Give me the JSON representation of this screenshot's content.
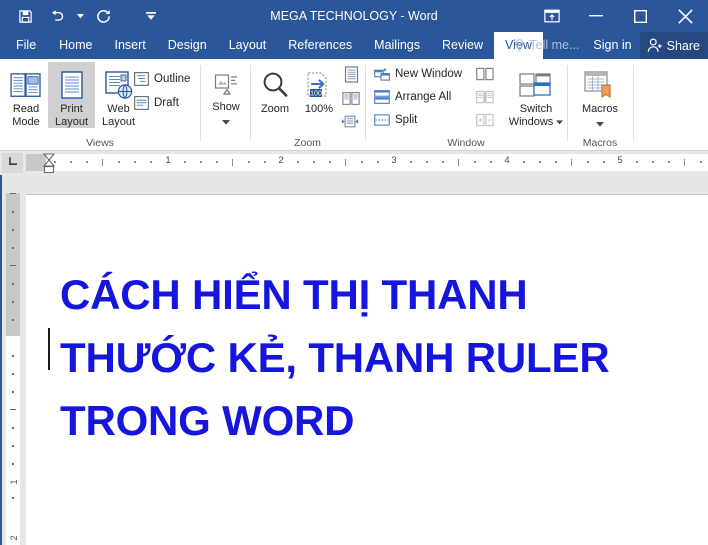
{
  "window": {
    "title": "MEGA TECHNOLOGY - Word",
    "accent_color": "#2b579a",
    "share_bg": "#23497f"
  },
  "quick_access": {
    "items": [
      {
        "name": "save-icon",
        "label": "Save"
      },
      {
        "name": "undo-icon",
        "label": "Undo"
      },
      {
        "name": "redo-icon",
        "label": "Redo"
      },
      {
        "name": "customize-quick-access-icon",
        "label": "Customize Quick Access Toolbar"
      }
    ]
  },
  "window_controls": {
    "ribbon_display_options": "Ribbon Display Options",
    "minimize": "Minimize",
    "maximize": "Maximize",
    "close": "Close"
  },
  "tabs": [
    {
      "label": "File",
      "active": false
    },
    {
      "label": "Home",
      "active": false
    },
    {
      "label": "Insert",
      "active": false
    },
    {
      "label": "Design",
      "active": false
    },
    {
      "label": "Layout",
      "active": false
    },
    {
      "label": "References",
      "active": false
    },
    {
      "label": "Mailings",
      "active": false
    },
    {
      "label": "Review",
      "active": false
    },
    {
      "label": "View",
      "active": true
    }
  ],
  "tab_right": {
    "tell_me": "Tell me...",
    "sign_in": "Sign in",
    "share": "Share"
  },
  "ribbon": {
    "groups": [
      {
        "name": "views",
        "label": "Views",
        "big_buttons": [
          {
            "label_line1": "Read",
            "label_line2": "Mode",
            "icon": "read-mode-icon",
            "selected": false
          },
          {
            "label_line1": "Print",
            "label_line2": "Layout",
            "icon": "print-layout-icon",
            "selected": true
          },
          {
            "label_line1": "Web",
            "label_line2": "Layout",
            "icon": "web-layout-icon",
            "selected": false
          }
        ],
        "small_buttons": [
          {
            "label": "Outline",
            "icon": "outline-view-icon"
          },
          {
            "label": "Draft",
            "icon": "draft-view-icon"
          }
        ]
      },
      {
        "name": "show",
        "label": "",
        "big_buttons": [
          {
            "label_line1": "Show",
            "label_line2": "",
            "icon": "show-icon",
            "selected": false,
            "has_dropdown": true
          }
        ],
        "small_buttons": []
      },
      {
        "name": "zoom",
        "label": "Zoom",
        "big_buttons": [
          {
            "label_line1": "Zoom",
            "label_line2": "",
            "icon": "zoom-magnifier-icon",
            "selected": false
          },
          {
            "label_line1": "100%",
            "label_line2": "",
            "icon": "zoom-100-icon",
            "selected": false
          }
        ],
        "small_buttons": [],
        "icon_only_buttons": [
          {
            "icon": "one-page-icon",
            "label": "One Page"
          },
          {
            "icon": "multiple-pages-icon",
            "label": "Multiple Pages"
          },
          {
            "icon": "page-width-icon",
            "label": "Page Width"
          }
        ]
      },
      {
        "name": "window",
        "label": "Window",
        "big_buttons": [
          {
            "label_line1": "Switch",
            "label_line2": "Windows",
            "icon": "switch-windows-icon",
            "selected": false,
            "has_dropdown": true
          }
        ],
        "small_buttons": [
          {
            "label": "New Window",
            "icon": "new-window-icon"
          },
          {
            "label": "Arrange All",
            "icon": "arrange-all-icon"
          },
          {
            "label": "Split",
            "icon": "split-icon"
          }
        ],
        "icon_only_buttons": [
          {
            "icon": "view-side-by-side-icon",
            "label": "View Side by Side"
          },
          {
            "icon": "synchronous-scrolling-icon",
            "label": "Synchronous Scrolling"
          },
          {
            "icon": "reset-window-position-icon",
            "label": "Reset Window Position"
          }
        ]
      },
      {
        "name": "macros",
        "label": "Macros",
        "big_buttons": [
          {
            "label_line1": "Macros",
            "label_line2": "",
            "icon": "macros-icon",
            "selected": false,
            "has_dropdown": true
          }
        ],
        "small_buttons": []
      }
    ]
  },
  "ruler": {
    "horizontal_numbers": [
      "1",
      "2",
      "3",
      "4",
      "5"
    ],
    "vertical_numbers": [
      "1",
      "2"
    ],
    "tab_selector": "left-tab-stop-icon"
  },
  "document": {
    "text": "CÁCH HIỂN THỊ THANH THƯỚC KẺ, THANH RULER TRONG WORD",
    "text_color": "#1515dd",
    "lines": [
      "CÁCH HIỂN THỊ THANH",
      "THƯỚC KẺ, THANH RULER",
      "TRONG WORD"
    ]
  }
}
